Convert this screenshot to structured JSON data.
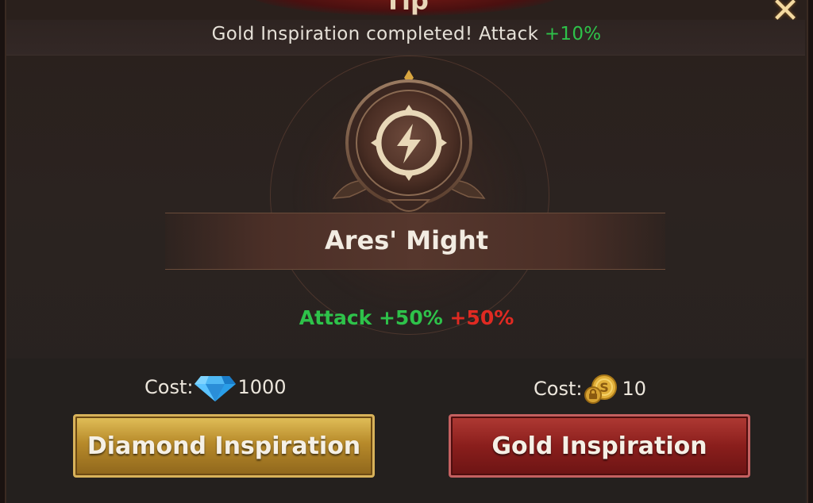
{
  "dialog": {
    "title": "Tip",
    "close_icon": "close-x-icon"
  },
  "notice": {
    "prefix": "Gold Inspiration completed! Attack ",
    "bonus": "+10%",
    "bonus_color": "#2ec24a"
  },
  "skill": {
    "icon": "lightning-emblem-icon",
    "name": "Ares' Might",
    "effect_label": "Attack +50%",
    "effect_bonus": " +50%",
    "effect_color": "#2ec24a",
    "bonus_color": "#e02a22"
  },
  "diamond_option": {
    "cost_label": "Cost:",
    "cost_icon": "diamond-icon",
    "cost_value": "1000",
    "button_label": "Diamond Inspiration",
    "button_color": "#c99a35"
  },
  "gold_option": {
    "cost_label": "Cost:",
    "cost_icon": "gold-coin-icon",
    "cost_value": "10",
    "button_label": "Gold Inspiration",
    "button_color": "#8a1e1c"
  }
}
